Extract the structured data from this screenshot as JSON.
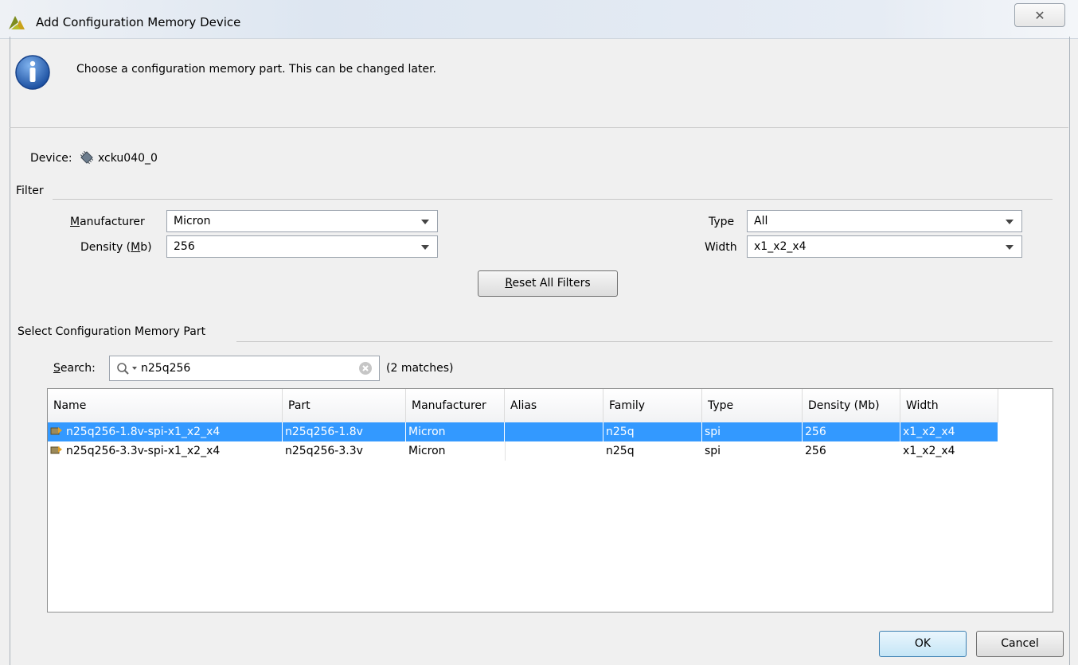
{
  "window": {
    "title": "Add Configuration Memory Device",
    "close_glyph": "✕"
  },
  "info": {
    "icon": "info-icon",
    "message": "Choose a configuration memory part. This can be changed later."
  },
  "device": {
    "label": "Device:",
    "icon": "chip-icon",
    "value": "xcku040_0"
  },
  "filter": {
    "section_label": "Filter",
    "manufacturer": {
      "label_underlined": "M",
      "label_rest": "anufacturer",
      "value": "Micron"
    },
    "density": {
      "label_pre": "Density (",
      "label_underlined": "M",
      "label_post": "b)",
      "value": "256"
    },
    "type": {
      "label": "Type",
      "value": "All"
    },
    "width": {
      "label": "Width",
      "value": "x1_x2_x4"
    },
    "reset_underlined": "R",
    "reset_rest": "eset All Filters"
  },
  "parts": {
    "section_label": "Select Configuration Memory Part",
    "search_label_underlined": "S",
    "search_label_rest": "earch:",
    "search_value": "n25q256",
    "match_count": "(2 matches)",
    "columns": [
      "Name",
      "Part",
      "Manufacturer",
      "Alias",
      "Family",
      "Type",
      "Density (Mb)",
      "Width"
    ],
    "rows": [
      {
        "name": "n25q256-1.8v-spi-x1_x2_x4",
        "part": "n25q256-1.8v",
        "manufacturer": "Micron",
        "alias": "",
        "family": "n25q",
        "type": "spi",
        "density": "256",
        "width": "x1_x2_x4",
        "selected": true
      },
      {
        "name": "n25q256-3.3v-spi-x1_x2_x4",
        "part": "n25q256-3.3v",
        "manufacturer": "Micron",
        "alias": "",
        "family": "n25q",
        "type": "spi",
        "density": "256",
        "width": "x1_x2_x4",
        "selected": false
      }
    ]
  },
  "buttons": {
    "ok": "OK",
    "cancel": "Cancel"
  },
  "colors": {
    "selection": "#3399ff",
    "info_blue": "#1f5fb4",
    "app_accent": "#8a9a2a"
  }
}
